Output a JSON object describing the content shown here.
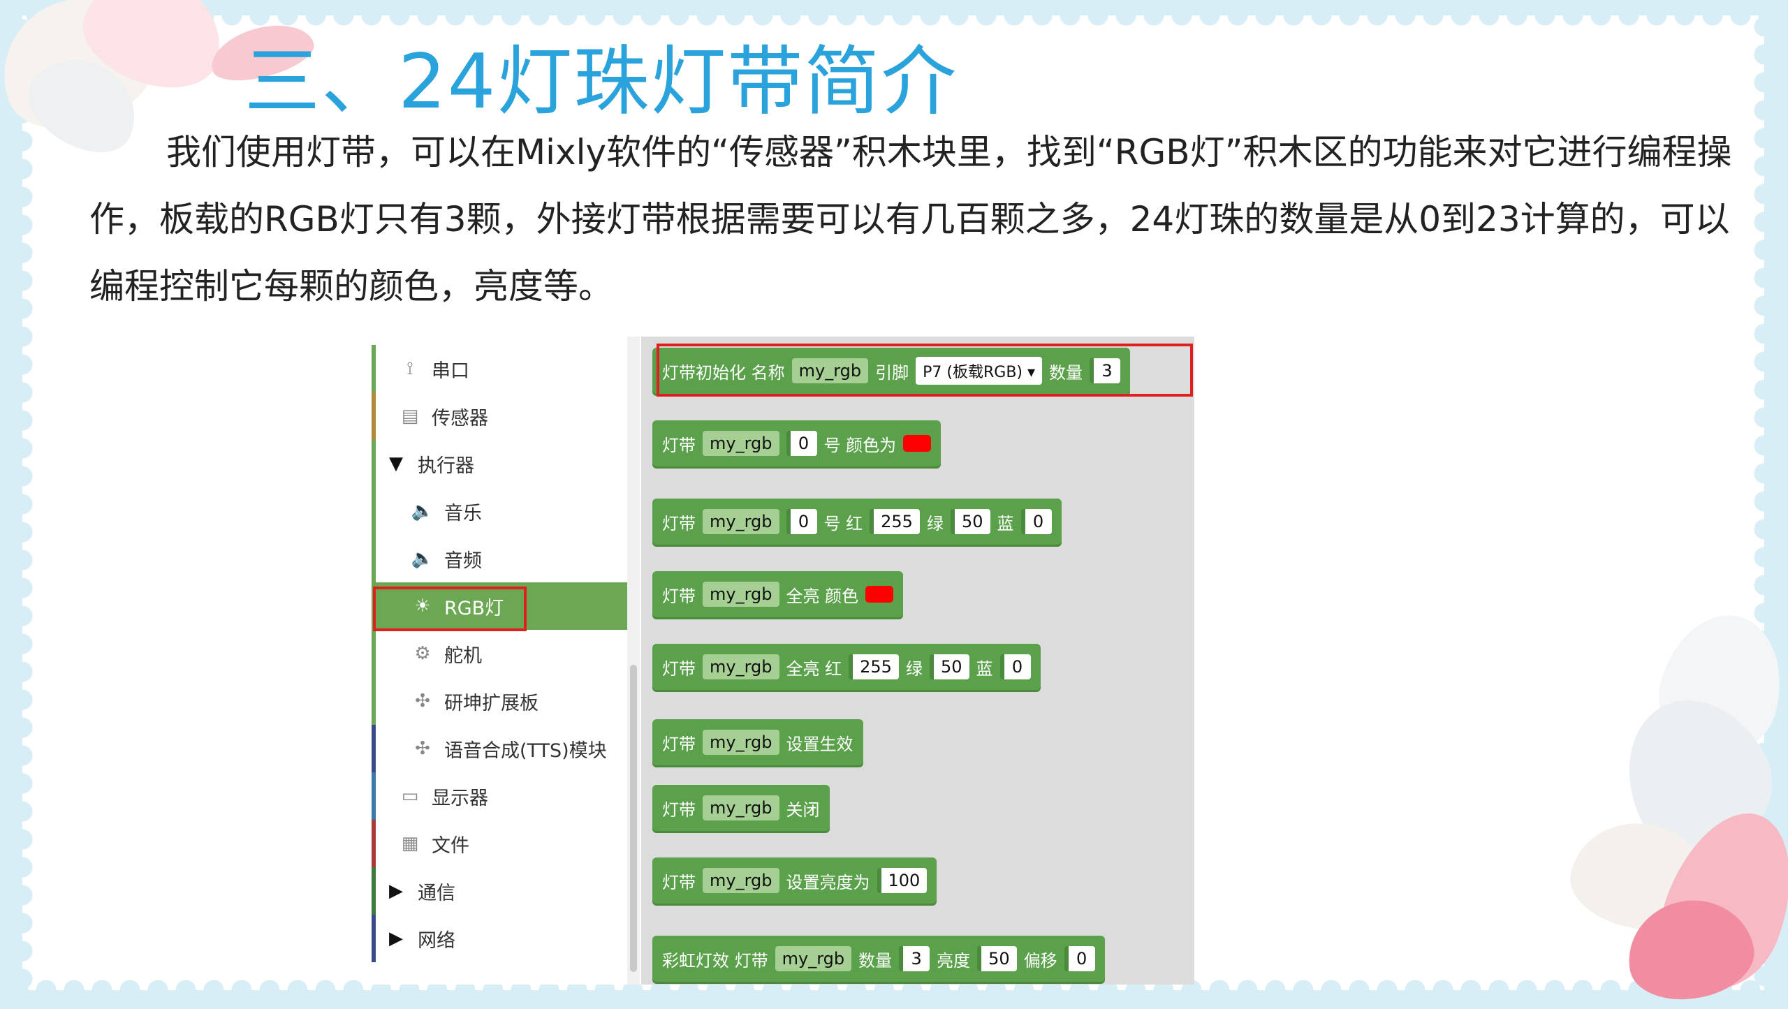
{
  "title": "三、24灯珠灯带简介",
  "paragraph": "我们使用灯带，可以在Mixly软件的“传感器”积木块里，找到“RGB灯”积木区的功能来对它进行编程操作，板载的RGB灯只有3颗，外接灯带根据需要可以有几百颗之多，24灯珠的数量是从0到23计算的，可以编程控制它每颗的颜色，亮度等。",
  "sidebar": {
    "items": [
      {
        "label": "串口",
        "icon": "serial-icon",
        "color": "#6ca854"
      },
      {
        "label": "传感器",
        "icon": "sensor-icon",
        "color": "#b08a3a"
      },
      {
        "label": "执行器",
        "icon": "expand-triangle-icon",
        "color": "#6ca854"
      },
      {
        "label": "音乐",
        "icon": "speaker-icon",
        "color": "#6ca854"
      },
      {
        "label": "音频",
        "icon": "speaker-icon",
        "color": "#6ca854"
      },
      {
        "label": "RGB灯",
        "icon": "bulb-icon",
        "color": "#6ca854"
      },
      {
        "label": "舵机",
        "icon": "servo-icon",
        "color": "#6ca854"
      },
      {
        "label": "研坤扩展板",
        "icon": "network-node-icon",
        "color": "#6ca854"
      },
      {
        "label": "语音合成(TTS)模块",
        "icon": "network-node-icon",
        "color": "#3a4a8a"
      },
      {
        "label": "显示器",
        "icon": "monitor-icon",
        "color": "#3a7aa8"
      },
      {
        "label": "文件",
        "icon": "file-icon",
        "color": "#a83a3a"
      },
      {
        "label": "通信",
        "icon": "collapsed-triangle-icon",
        "color": "#3a7a3a"
      },
      {
        "label": "网络",
        "icon": "collapsed-triangle-icon",
        "color": "#3a4a8a"
      }
    ]
  },
  "blocks": [
    {
      "parts": [
        {
          "t": "lbl",
          "v": "灯带初始化 名称"
        },
        {
          "t": "var",
          "v": "my_rgb"
        },
        {
          "t": "lbl",
          "v": "引脚"
        },
        {
          "t": "dd",
          "v": "P7 (板载RGB) ▾"
        },
        {
          "t": "lbl",
          "v": "数量"
        },
        {
          "t": "num",
          "v": "3"
        }
      ]
    },
    {
      "parts": [
        {
          "t": "lbl",
          "v": "灯带"
        },
        {
          "t": "var",
          "v": "my_rgb"
        },
        {
          "t": "num",
          "v": "0"
        },
        {
          "t": "lbl",
          "v": "号 颜色为"
        },
        {
          "t": "swatch",
          "v": ""
        }
      ]
    },
    {
      "parts": [
        {
          "t": "lbl",
          "v": "灯带"
        },
        {
          "t": "var",
          "v": "my_rgb"
        },
        {
          "t": "num",
          "v": "0"
        },
        {
          "t": "lbl",
          "v": "号 红"
        },
        {
          "t": "num",
          "v": "255"
        },
        {
          "t": "lbl",
          "v": "绿"
        },
        {
          "t": "num",
          "v": "50"
        },
        {
          "t": "lbl",
          "v": "蓝"
        },
        {
          "t": "num",
          "v": "0"
        }
      ]
    },
    {
      "parts": [
        {
          "t": "lbl",
          "v": "灯带"
        },
        {
          "t": "var",
          "v": "my_rgb"
        },
        {
          "t": "lbl",
          "v": "全亮 颜色"
        },
        {
          "t": "swatch",
          "v": ""
        }
      ]
    },
    {
      "parts": [
        {
          "t": "lbl",
          "v": "灯带"
        },
        {
          "t": "var",
          "v": "my_rgb"
        },
        {
          "t": "lbl",
          "v": "全亮 红"
        },
        {
          "t": "num",
          "v": "255"
        },
        {
          "t": "lbl",
          "v": "绿"
        },
        {
          "t": "num",
          "v": "50"
        },
        {
          "t": "lbl",
          "v": "蓝"
        },
        {
          "t": "num",
          "v": "0"
        }
      ]
    },
    {
      "parts": [
        {
          "t": "lbl",
          "v": "灯带"
        },
        {
          "t": "var",
          "v": "my_rgb"
        },
        {
          "t": "lbl",
          "v": "设置生效"
        }
      ]
    },
    {
      "parts": [
        {
          "t": "lbl",
          "v": "灯带"
        },
        {
          "t": "var",
          "v": "my_rgb"
        },
        {
          "t": "lbl",
          "v": "关闭"
        }
      ]
    },
    {
      "parts": [
        {
          "t": "lbl",
          "v": "灯带"
        },
        {
          "t": "var",
          "v": "my_rgb"
        },
        {
          "t": "lbl",
          "v": "设置亮度为"
        },
        {
          "t": "num",
          "v": "100"
        }
      ]
    },
    {
      "parts": [
        {
          "t": "lbl",
          "v": "彩虹灯效 灯带"
        },
        {
          "t": "var",
          "v": "my_rgb"
        },
        {
          "t": "lbl",
          "v": "数量"
        },
        {
          "t": "num",
          "v": "3"
        },
        {
          "t": "lbl",
          "v": "亮度"
        },
        {
          "t": "num",
          "v": "50"
        },
        {
          "t": "lbl",
          "v": "偏移"
        },
        {
          "t": "num",
          "v": "0"
        }
      ]
    }
  ],
  "colors": {
    "accent": "#2aa3dc",
    "block_green": "#5ba14b",
    "highlight_red": "#e02020"
  }
}
